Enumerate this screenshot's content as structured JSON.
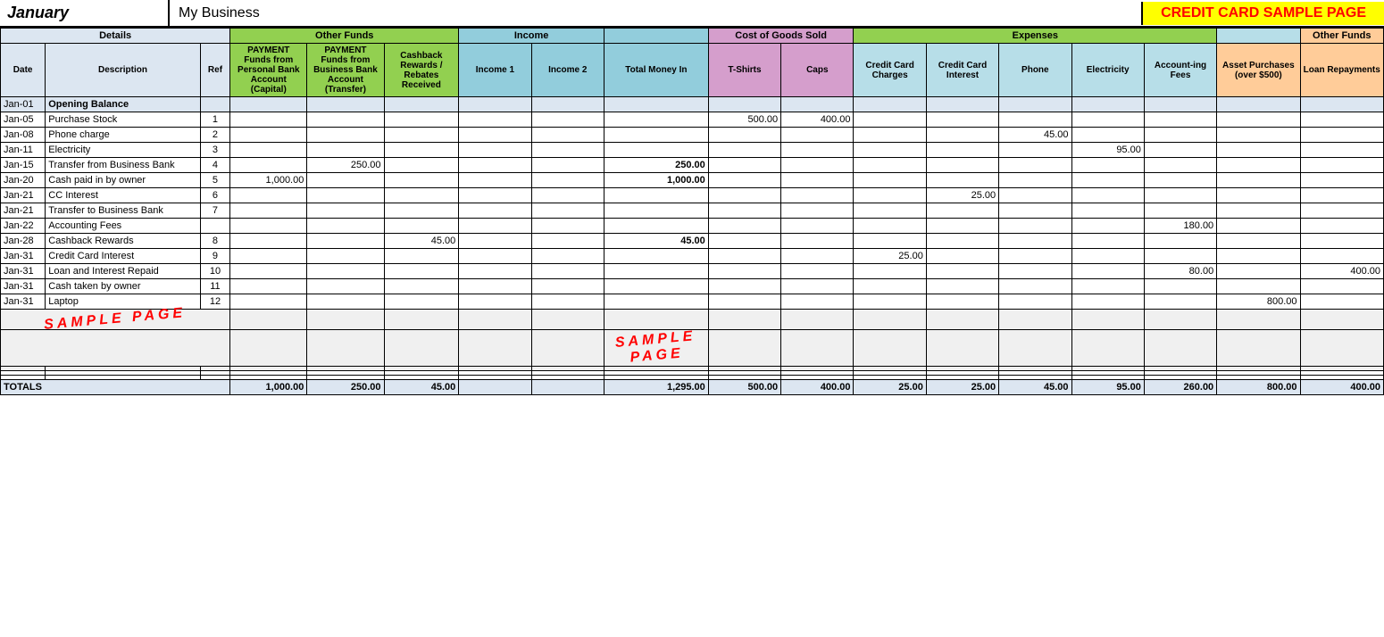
{
  "header": {
    "month": "January",
    "business": "My Business",
    "sample_title": "CREDIT CARD SAMPLE PAGE"
  },
  "groups": {
    "details": "Details",
    "other_funds": "Other Funds",
    "income": "Income",
    "cogs": "Cost of Goods Sold",
    "expenses": "Expenses",
    "other_funds2": "Other Funds"
  },
  "columns": {
    "date": "Date",
    "description": "Description",
    "ref": "Ref",
    "pmt_personal": "PAYMENT Funds from Personal Bank Account (Capital)",
    "pmt_business": "PAYMENT Funds from Business Bank Account (Transfer)",
    "cashback": "Cashback Rewards / Rebates Received",
    "income1": "Income 1",
    "income2": "Income 2",
    "total_money": "Total Money In",
    "tshirts": "T-Shirts",
    "caps": "Caps",
    "cc_charges": "Credit Card Charges",
    "cc_interest": "Credit Card Interest",
    "phone": "Phone",
    "electricity": "Electricity",
    "acct_fees": "Account-ing Fees",
    "asset": "Asset Purchases (over $500)",
    "loan": "Loan Repayments"
  },
  "rows": [
    {
      "date": "Jan-01",
      "desc": "Opening Balance",
      "ref": "",
      "pmt_personal": "",
      "pmt_business": "",
      "cashback": "",
      "income1": "",
      "income2": "",
      "total": "",
      "tshirts": "",
      "caps": "",
      "cc_charges": "",
      "cc_interest": "",
      "phone": "",
      "electricity": "",
      "acct_fees": "",
      "asset": "",
      "loan": "",
      "type": "opening"
    },
    {
      "date": "Jan-05",
      "desc": "Purchase Stock",
      "ref": "1",
      "pmt_personal": "",
      "pmt_business": "",
      "cashback": "",
      "income1": "",
      "income2": "",
      "total": "",
      "tshirts": "500.00",
      "caps": "400.00",
      "cc_charges": "",
      "cc_interest": "",
      "phone": "",
      "electricity": "",
      "acct_fees": "",
      "asset": "",
      "loan": "",
      "type": "data"
    },
    {
      "date": "Jan-08",
      "desc": "Phone charge",
      "ref": "2",
      "pmt_personal": "",
      "pmt_business": "",
      "cashback": "",
      "income1": "",
      "income2": "",
      "total": "",
      "tshirts": "",
      "caps": "",
      "cc_charges": "",
      "cc_interest": "",
      "phone": "45.00",
      "electricity": "",
      "acct_fees": "",
      "asset": "",
      "loan": "",
      "type": "data"
    },
    {
      "date": "Jan-11",
      "desc": "Electricity",
      "ref": "3",
      "pmt_personal": "",
      "pmt_business": "",
      "cashback": "",
      "income1": "",
      "income2": "",
      "total": "",
      "tshirts": "",
      "caps": "",
      "cc_charges": "",
      "cc_interest": "",
      "phone": "",
      "electricity": "95.00",
      "acct_fees": "",
      "asset": "",
      "loan": "",
      "type": "data"
    },
    {
      "date": "Jan-15",
      "desc": "Transfer from Business Bank",
      "ref": "4",
      "pmt_personal": "",
      "pmt_business": "250.00",
      "cashback": "",
      "income1": "",
      "income2": "",
      "total": "250.00",
      "tshirts": "",
      "caps": "",
      "cc_charges": "",
      "cc_interest": "",
      "phone": "",
      "electricity": "",
      "acct_fees": "",
      "asset": "",
      "loan": "",
      "type": "data"
    },
    {
      "date": "Jan-20",
      "desc": "Cash paid in by owner",
      "ref": "5",
      "pmt_personal": "1,000.00",
      "pmt_business": "",
      "cashback": "",
      "income1": "",
      "income2": "",
      "total": "1,000.00",
      "tshirts": "",
      "caps": "",
      "cc_charges": "",
      "cc_interest": "",
      "phone": "",
      "electricity": "",
      "acct_fees": "",
      "asset": "",
      "loan": "",
      "type": "data"
    },
    {
      "date": "Jan-21",
      "desc": "CC Interest",
      "ref": "6",
      "pmt_personal": "",
      "pmt_business": "",
      "cashback": "",
      "income1": "",
      "income2": "",
      "total": "",
      "tshirts": "",
      "caps": "",
      "cc_charges": "",
      "cc_interest": "25.00",
      "phone": "",
      "electricity": "",
      "acct_fees": "",
      "asset": "",
      "loan": "",
      "type": "data"
    },
    {
      "date": "Jan-21",
      "desc": "Transfer to Business Bank",
      "ref": "7",
      "pmt_personal": "",
      "pmt_business": "",
      "cashback": "",
      "income1": "",
      "income2": "",
      "total": "",
      "tshirts": "",
      "caps": "",
      "cc_charges": "",
      "cc_interest": "",
      "phone": "",
      "electricity": "",
      "acct_fees": "",
      "asset": "",
      "loan": "",
      "type": "data"
    },
    {
      "date": "Jan-22",
      "desc": "Accounting Fees",
      "ref": "",
      "pmt_personal": "",
      "pmt_business": "",
      "cashback": "",
      "income1": "",
      "income2": "",
      "total": "",
      "tshirts": "",
      "caps": "",
      "cc_charges": "",
      "cc_interest": "",
      "phone": "",
      "electricity": "",
      "acct_fees": "180.00",
      "asset": "",
      "loan": "",
      "type": "data"
    },
    {
      "date": "Jan-28",
      "desc": "Cashback Rewards",
      "ref": "8",
      "pmt_personal": "",
      "pmt_business": "",
      "cashback": "45.00",
      "income1": "",
      "income2": "",
      "total": "45.00",
      "tshirts": "",
      "caps": "",
      "cc_charges": "",
      "cc_interest": "",
      "phone": "",
      "electricity": "",
      "acct_fees": "",
      "asset": "",
      "loan": "",
      "type": "data"
    },
    {
      "date": "Jan-31",
      "desc": "Credit Card Interest",
      "ref": "9",
      "pmt_personal": "",
      "pmt_business": "",
      "cashback": "",
      "income1": "",
      "income2": "",
      "total": "",
      "tshirts": "",
      "caps": "",
      "cc_charges": "25.00",
      "cc_interest": "",
      "phone": "",
      "electricity": "",
      "acct_fees": "",
      "asset": "",
      "loan": "",
      "type": "data"
    },
    {
      "date": "Jan-31",
      "desc": "Loan and Interest Repaid",
      "ref": "10",
      "pmt_personal": "",
      "pmt_business": "",
      "cashback": "",
      "income1": "",
      "income2": "",
      "total": "",
      "tshirts": "",
      "caps": "",
      "cc_charges": "",
      "cc_interest": "",
      "phone": "",
      "electricity": "",
      "acct_fees": "80.00",
      "asset": "",
      "loan": "400.00",
      "type": "data"
    },
    {
      "date": "Jan-31",
      "desc": "Cash taken by owner",
      "ref": "11",
      "pmt_personal": "",
      "pmt_business": "",
      "cashback": "",
      "income1": "",
      "income2": "",
      "total": "",
      "tshirts": "",
      "caps": "",
      "cc_charges": "",
      "cc_interest": "",
      "phone": "",
      "electricity": "",
      "acct_fees": "",
      "asset": "",
      "loan": "",
      "type": "data"
    },
    {
      "date": "Jan-31",
      "desc": "Laptop",
      "ref": "12",
      "pmt_personal": "",
      "pmt_business": "",
      "cashback": "",
      "income1": "",
      "income2": "",
      "total": "",
      "tshirts": "",
      "caps": "",
      "cc_charges": "",
      "cc_interest": "",
      "phone": "",
      "electricity": "",
      "acct_fees": "",
      "asset": "800.00",
      "loan": "",
      "type": "data"
    },
    {
      "date": "",
      "desc": "",
      "ref": "",
      "pmt_personal": "",
      "pmt_business": "",
      "cashback": "",
      "income1": "",
      "income2": "",
      "total": "",
      "tshirts": "",
      "caps": "",
      "cc_charges": "",
      "cc_interest": "",
      "phone": "",
      "electricity": "",
      "acct_fees": "",
      "asset": "",
      "loan": "",
      "type": "sample"
    },
    {
      "date": "",
      "desc": "",
      "ref": "",
      "pmt_personal": "",
      "pmt_business": "",
      "cashback": "",
      "income1": "",
      "income2": "",
      "total": "",
      "tshirts": "",
      "caps": "",
      "cc_charges": "",
      "cc_interest": "",
      "phone": "",
      "electricity": "",
      "acct_fees": "",
      "asset": "",
      "loan": "",
      "type": "sample"
    },
    {
      "date": "",
      "desc": "",
      "ref": "",
      "pmt_personal": "",
      "pmt_business": "",
      "cashback": "",
      "income1": "",
      "income2": "",
      "total": "",
      "tshirts": "",
      "caps": "",
      "cc_charges": "",
      "cc_interest": "",
      "phone": "",
      "electricity": "",
      "acct_fees": "",
      "asset": "",
      "loan": "",
      "type": "sample"
    },
    {
      "date": "",
      "desc": "",
      "ref": "",
      "pmt_personal": "",
      "pmt_business": "",
      "cashback": "",
      "income1": "",
      "income2": "",
      "total": "",
      "tshirts": "",
      "caps": "",
      "cc_charges": "",
      "cc_interest": "",
      "phone": "",
      "electricity": "",
      "acct_fees": "",
      "asset": "",
      "loan": "",
      "type": "blank"
    },
    {
      "date": "",
      "desc": "",
      "ref": "",
      "pmt_personal": "",
      "pmt_business": "",
      "cashback": "",
      "income1": "",
      "income2": "",
      "total": "",
      "tshirts": "",
      "caps": "",
      "cc_charges": "",
      "cc_interest": "",
      "phone": "",
      "electricity": "",
      "acct_fees": "",
      "asset": "",
      "loan": "",
      "type": "blank"
    }
  ],
  "totals": {
    "label": "TOTALS",
    "pmt_personal": "1,000.00",
    "pmt_business": "250.00",
    "cashback": "45.00",
    "income1": "",
    "income2": "",
    "total": "1,295.00",
    "tshirts": "500.00",
    "caps": "400.00",
    "cc_charges": "25.00",
    "cc_interest": "25.00",
    "phone": "45.00",
    "electricity": "95.00",
    "acct_fees": "260.00",
    "asset": "800.00",
    "loan": "400.00"
  },
  "sample_text_left": "SAMPLE PAGE",
  "sample_text_center": "SAMPLE PAGE"
}
